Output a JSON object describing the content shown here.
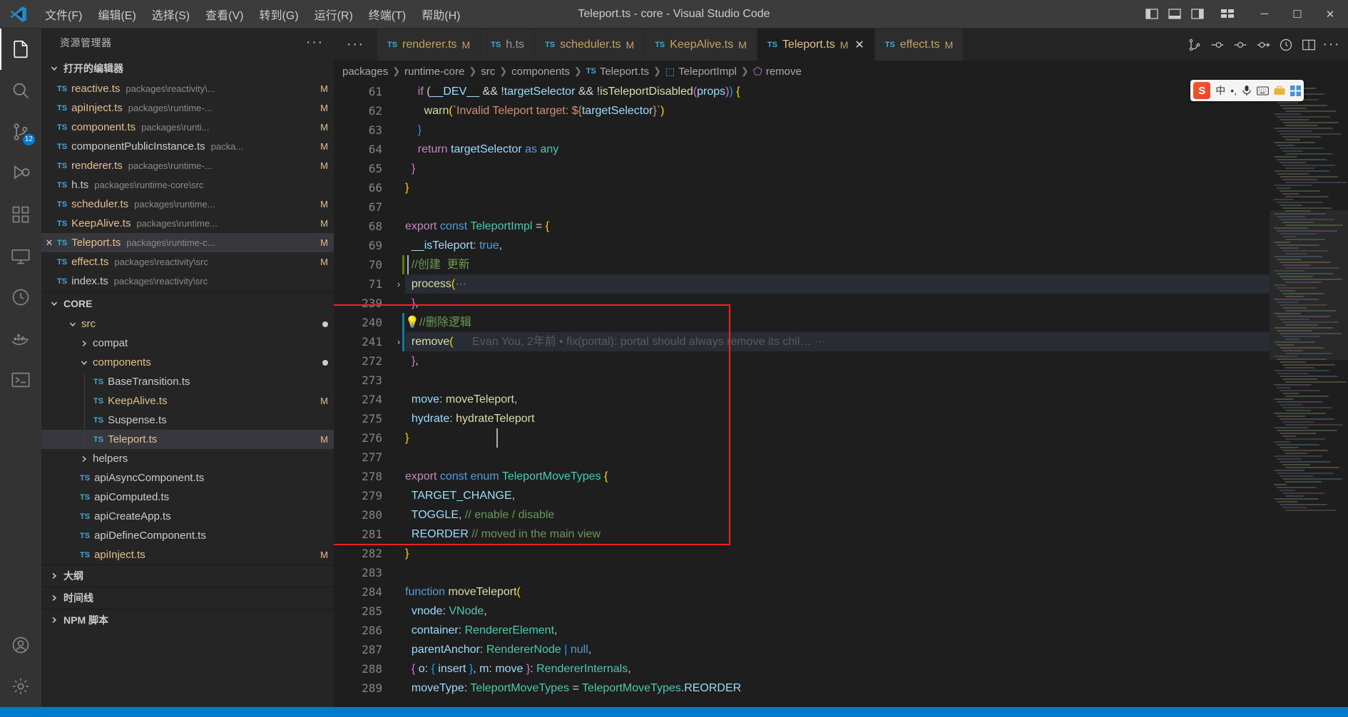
{
  "window": {
    "title": "Teleport.ts - core - Visual Studio Code",
    "logo_name": "vscode-logo"
  },
  "menubar": [
    {
      "label": "文件(F)",
      "name": "menu-file"
    },
    {
      "label": "编辑(E)",
      "name": "menu-edit"
    },
    {
      "label": "选择(S)",
      "name": "menu-selection"
    },
    {
      "label": "查看(V)",
      "name": "menu-view"
    },
    {
      "label": "转到(G)",
      "name": "menu-go"
    },
    {
      "label": "运行(R)",
      "name": "menu-run"
    },
    {
      "label": "终端(T)",
      "name": "menu-terminal"
    },
    {
      "label": "帮助(H)",
      "name": "menu-help"
    }
  ],
  "window_controls": {
    "minimize": "─",
    "maximize": "☐",
    "close": "✕"
  },
  "activity_bar": {
    "items": [
      {
        "name": "explorer-icon",
        "label": "资源管理器",
        "active": true,
        "badge": ""
      },
      {
        "name": "search-icon",
        "label": "搜索",
        "active": false,
        "badge": ""
      },
      {
        "name": "source-control-icon",
        "label": "源代码管理",
        "active": false,
        "badge": "12"
      },
      {
        "name": "run-debug-icon",
        "label": "运行和调试",
        "active": false,
        "badge": ""
      },
      {
        "name": "extensions-icon",
        "label": "扩展",
        "active": false,
        "badge": ""
      },
      {
        "name": "remote-explorer-icon",
        "label": "远程资源管理器",
        "active": false,
        "badge": ""
      },
      {
        "name": "clock-history-icon",
        "label": "时间线",
        "active": false,
        "badge": ""
      },
      {
        "name": "docker-icon",
        "label": "Docker",
        "active": false,
        "badge": ""
      },
      {
        "name": "terminal-icon",
        "label": "终端",
        "active": false,
        "badge": ""
      }
    ],
    "bottom": [
      {
        "name": "account-icon",
        "label": "账户"
      },
      {
        "name": "settings-gear-icon",
        "label": "管理"
      }
    ]
  },
  "sidebar": {
    "title": "资源管理器",
    "more_actions": "···",
    "open_editors": {
      "label": "打开的编辑器",
      "items": [
        {
          "file": "reactive.ts",
          "path": "packages\\reactivity\\...",
          "badge": "M",
          "active": false,
          "modified": true
        },
        {
          "file": "apiInject.ts",
          "path": "packages\\runtime-...",
          "badge": "M",
          "active": false,
          "modified": true
        },
        {
          "file": "component.ts",
          "path": "packages\\runti...",
          "badge": "M",
          "active": false,
          "modified": true
        },
        {
          "file": "componentPublicInstance.ts",
          "path": "packa...",
          "badge": "M",
          "active": false,
          "modified": true
        },
        {
          "file": "renderer.ts",
          "path": "packages\\runtime-...",
          "badge": "M",
          "active": false,
          "modified": true
        },
        {
          "file": "h.ts",
          "path": "packages\\runtime-core\\src",
          "badge": "",
          "active": false,
          "modified": false
        },
        {
          "file": "scheduler.ts",
          "path": "packages\\runtime...",
          "badge": "M",
          "active": false,
          "modified": true
        },
        {
          "file": "KeepAlive.ts",
          "path": "packages\\runtime...",
          "badge": "M",
          "active": false,
          "modified": true
        },
        {
          "file": "Teleport.ts",
          "path": "packages\\runtime-c...",
          "badge": "M",
          "active": true,
          "modified": true
        },
        {
          "file": "effect.ts",
          "path": "packages\\reactivity\\src",
          "badge": "M",
          "active": false,
          "modified": true
        },
        {
          "file": "index.ts",
          "path": "packages\\reactivity\\src",
          "badge": "",
          "active": false,
          "modified": false
        }
      ]
    },
    "core_section": {
      "label": "CORE",
      "tree": [
        {
          "type": "folder",
          "name": "src",
          "depth": 1,
          "expanded": true,
          "dot": true
        },
        {
          "type": "folder",
          "name": "compat",
          "depth": 2,
          "expanded": false,
          "dot": false
        },
        {
          "type": "folder",
          "name": "components",
          "depth": 2,
          "expanded": true,
          "dot": true
        },
        {
          "type": "file",
          "name": "BaseTransition.ts",
          "depth": 3,
          "badge": "",
          "modified": false,
          "selected": false
        },
        {
          "type": "file",
          "name": "KeepAlive.ts",
          "depth": 3,
          "badge": "M",
          "modified": true,
          "selected": false
        },
        {
          "type": "file",
          "name": "Suspense.ts",
          "depth": 3,
          "badge": "",
          "modified": false,
          "selected": false
        },
        {
          "type": "file",
          "name": "Teleport.ts",
          "depth": 3,
          "badge": "M",
          "modified": true,
          "selected": true
        },
        {
          "type": "folder",
          "name": "helpers",
          "depth": 2,
          "expanded": false,
          "dot": false
        },
        {
          "type": "file",
          "name": "apiAsyncComponent.ts",
          "depth": 2,
          "badge": "",
          "modified": false,
          "selected": false
        },
        {
          "type": "file",
          "name": "apiComputed.ts",
          "depth": 2,
          "badge": "",
          "modified": false,
          "selected": false
        },
        {
          "type": "file",
          "name": "apiCreateApp.ts",
          "depth": 2,
          "badge": "",
          "modified": false,
          "selected": false
        },
        {
          "type": "file",
          "name": "apiDefineComponent.ts",
          "depth": 2,
          "badge": "",
          "modified": false,
          "selected": false
        },
        {
          "type": "file",
          "name": "apiInject.ts",
          "depth": 2,
          "badge": "M",
          "modified": true,
          "selected": false
        }
      ]
    },
    "bottom_sections": [
      {
        "label": "大纲",
        "name": "outline-section"
      },
      {
        "label": "时间线",
        "name": "timeline-section"
      },
      {
        "label": "NPM 脚本",
        "name": "npm-scripts-section"
      }
    ]
  },
  "tabs": [
    {
      "file": "renderer.ts",
      "badge": "M",
      "active": false,
      "closable": false
    },
    {
      "file": "h.ts",
      "badge": "",
      "active": false,
      "closable": false
    },
    {
      "file": "scheduler.ts",
      "badge": "M",
      "active": false,
      "closable": false
    },
    {
      "file": "KeepAlive.ts",
      "badge": "M",
      "active": false,
      "closable": false
    },
    {
      "file": "Teleport.ts",
      "badge": "M",
      "active": true,
      "closable": true
    },
    {
      "file": "effect.ts",
      "badge": "M",
      "active": false,
      "closable": false
    }
  ],
  "tab_overflow": "···",
  "tab_actions": [
    {
      "name": "source-control-compare-icon"
    },
    {
      "name": "run-code-icon"
    },
    {
      "name": "debug-start-icon"
    },
    {
      "name": "run-with-args-icon"
    },
    {
      "name": "timer-icon"
    },
    {
      "name": "split-editor-icon"
    },
    {
      "name": "editor-more-actions-icon"
    }
  ],
  "breadcrumb": [
    {
      "label": "packages",
      "icon": ""
    },
    {
      "label": "runtime-core",
      "icon": ""
    },
    {
      "label": "src",
      "icon": ""
    },
    {
      "label": "components",
      "icon": ""
    },
    {
      "label": "Teleport.ts",
      "icon": "ts"
    },
    {
      "label": "TeleportImpl",
      "icon": "object"
    },
    {
      "label": "remove",
      "icon": "method"
    }
  ],
  "ime_toolbar": {
    "logo": "S",
    "mode": "中",
    "items": [
      "中",
      "•,",
      "mic-icon",
      "keyboard-icon",
      "toolbox-icon",
      "apps-icon"
    ]
  },
  "code": {
    "lines": [
      {
        "num": "61",
        "fold": "",
        "html": "    <span class='t-key'>if</span> (<span class='t-var'>__DEV__</span> <span class='t-op'>&amp;&amp;</span> <span class='t-op'>!</span><span class='t-var'>targetSelector</span> <span class='t-op'>&amp;&amp;</span> <span class='t-op'>!</span><span class='t-fn'>isTeleportDisabled</span><span class='t-brace-p'>(</span><span class='t-var'>props</span><span class='t-brace-p'>)</span><span class='t-brace-b'>)</span> <span class='t-brace-y'>{</span>"
      },
      {
        "num": "62",
        "fold": "",
        "html": "      <span class='t-fn'>warn</span><span class='t-brace-y'>(</span><span class='t-str'>`Invalid Teleport target: ${</span><span class='t-var'>targetSelector</span><span class='t-str'>}`</span><span class='t-brace-y'>)</span>"
      },
      {
        "num": "63",
        "fold": "",
        "html": "    <span class='t-brace-b'>}</span>"
      },
      {
        "num": "64",
        "fold": "",
        "html": "    <span class='t-key'>return</span> <span class='t-var'>targetSelector</span> <span class='t-kw2'>as</span> <span class='t-type'>any</span>"
      },
      {
        "num": "65",
        "fold": "",
        "html": "  <span class='t-brace-p'>}</span>"
      },
      {
        "num": "66",
        "fold": "",
        "html": "<span class='t-brace-y'>}</span>"
      },
      {
        "num": "67",
        "fold": "",
        "html": ""
      },
      {
        "num": "68",
        "fold": "",
        "html": "<span class='t-key'>export</span> <span class='t-kw2'>const</span> <span class='t-type'>TeleportImpl</span> <span class='t-op'>=</span> <span class='t-brace-y'>{</span>"
      },
      {
        "num": "69",
        "fold": "",
        "html": "  <span class='t-var'>__isTeleport</span>: <span class='t-kw2'>true</span>,"
      },
      {
        "num": "70",
        "fold": "",
        "html": "  <span class='t-cmt'>//创建  更新</span>"
      },
      {
        "num": "71",
        "fold": "›",
        "hl": true,
        "html": "  <span class='t-fn'>process</span><span class='t-brace-y'>(</span><span class='t-fold'>···</span>"
      },
      {
        "num": "239",
        "fold": "",
        "html": "  <span class='t-brace-p'>}</span>,"
      },
      {
        "num": "240",
        "fold": "",
        "html": "<span class='bulb'>💡</span><span class='t-cmt'>//删除逻辑</span>"
      },
      {
        "num": "241",
        "fold": "›",
        "hl": true,
        "html": "  <span class='t-fn'>remove</span><span class='t-brace-y'>(</span>      <span class='t-blame'>Evan You, 2年前 • fix(portal): portal should always remove its chil… ···</span>"
      },
      {
        "num": "272",
        "fold": "",
        "html": "  <span class='t-brace-p'>}</span>,"
      },
      {
        "num": "273",
        "fold": "",
        "html": ""
      },
      {
        "num": "274",
        "fold": "",
        "html": "  <span class='t-var'>move</span>: <span class='t-fn'>moveTeleport</span>,"
      },
      {
        "num": "275",
        "fold": "",
        "html": "  <span class='t-var'>hydrate</span>: <span class='t-fn'>hydrateTeleport</span>"
      },
      {
        "num": "276",
        "fold": "",
        "html": "<span class='t-brace-y'>}</span>"
      },
      {
        "num": "277",
        "fold": "",
        "html": ""
      },
      {
        "num": "278",
        "fold": "",
        "html": "<span class='t-key'>export</span> <span class='t-kw2'>const</span> <span class='t-kw2'>enum</span> <span class='t-type'>TeleportMoveTypes</span> <span class='t-brace-y'>{</span>"
      },
      {
        "num": "279",
        "fold": "",
        "html": "  <span class='t-var'>TARGET_CHANGE</span>,"
      },
      {
        "num": "280",
        "fold": "",
        "html": "  <span class='t-var'>TOGGLE</span>, <span class='t-cmt'>// enable / disable</span>"
      },
      {
        "num": "281",
        "fold": "",
        "html": "  <span class='t-var'>REORDER</span> <span class='t-cmt'>// moved in the main view</span>"
      },
      {
        "num": "282",
        "fold": "",
        "html": "<span class='t-brace-y'>}</span>"
      },
      {
        "num": "283",
        "fold": "",
        "html": ""
      },
      {
        "num": "284",
        "fold": "",
        "html": "<span class='t-kw2'>function</span> <span class='t-fn'>moveTeleport</span><span class='t-brace-y'>(</span>"
      },
      {
        "num": "285",
        "fold": "",
        "html": "  <span class='t-var'>vnode</span>: <span class='t-type'>VNode</span>,"
      },
      {
        "num": "286",
        "fold": "",
        "html": "  <span class='t-var'>container</span>: <span class='t-type'>RendererElement</span>,"
      },
      {
        "num": "287",
        "fold": "",
        "html": "  <span class='t-var'>parentAnchor</span>: <span class='t-type'>RendererNode</span> <span class='t-brace-b'>|</span> <span class='t-kw2'>null</span>,"
      },
      {
        "num": "288",
        "fold": "",
        "html": "  <span class='t-brace-p'>{</span> <span class='t-var'>o</span>: <span class='t-brace-b'>{</span> <span class='t-var'>insert</span> <span class='t-brace-b'>}</span>, <span class='t-var'>m</span>: <span class='t-var'>move</span> <span class='t-brace-p'>}</span>: <span class='t-type'>RendererInternals</span>,"
      },
      {
        "num": "289",
        "fold": "",
        "html": "  <span class='t-var'>moveType</span>: <span class='t-type'>TeleportMoveTypes</span> <span class='t-op'>=</span> <span class='t-type'>TeleportMoveTypes</span>.<span class='t-var'>REORDER</span>"
      }
    ]
  },
  "colors": {
    "accent": "#007acc",
    "highlight_box": "#ff1f1f",
    "tab_active_bg": "#1e1e1e",
    "editor_bg": "#1e1e1e",
    "sidebar_bg": "#252526",
    "activitybar_bg": "#333333",
    "titlebar_bg": "#3c3c3c",
    "modified_badge": "#e2c08d"
  }
}
